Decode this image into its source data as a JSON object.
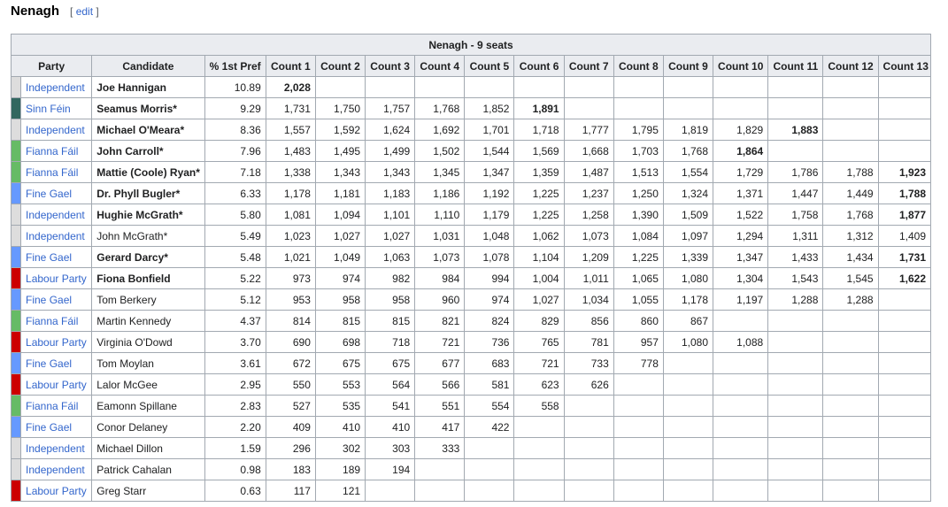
{
  "section": {
    "title": "Nenagh",
    "edit_open": "[ ",
    "edit_label": "edit",
    "edit_close": " ]"
  },
  "table": {
    "caption": "Nenagh - 9 seats",
    "headers": [
      "Party",
      "Candidate",
      "% 1st Pref",
      "Count 1",
      "Count 2",
      "Count 3",
      "Count 4",
      "Count 5",
      "Count 6",
      "Count 7",
      "Count 8",
      "Count 9",
      "Count 10",
      "Count 11",
      "Count 12",
      "Count 13"
    ],
    "rows": [
      {
        "party": "Independent",
        "color": "#dddddd",
        "candidate": "Joe Hannigan",
        "elected": true,
        "pct": "10.89",
        "counts": [
          "2,028"
        ],
        "bold_count": 0
      },
      {
        "party": "Sinn Féin",
        "color": "#326760",
        "candidate": "Seamus Morris*",
        "elected": true,
        "pct": "9.29",
        "counts": [
          "1,731",
          "1,750",
          "1,757",
          "1,768",
          "1,852",
          "1,891"
        ],
        "bold_count": 5
      },
      {
        "party": "Independent",
        "color": "#dddddd",
        "candidate": "Michael O'Meara*",
        "elected": true,
        "pct": "8.36",
        "counts": [
          "1,557",
          "1,592",
          "1,624",
          "1,692",
          "1,701",
          "1,718",
          "1,777",
          "1,795",
          "1,819",
          "1,829",
          "1,883"
        ],
        "bold_count": 10
      },
      {
        "party": "Fianna Fáil",
        "color": "#66bb66",
        "candidate": "John Carroll*",
        "elected": true,
        "pct": "7.96",
        "counts": [
          "1,483",
          "1,495",
          "1,499",
          "1,502",
          "1,544",
          "1,569",
          "1,668",
          "1,703",
          "1,768",
          "1,864"
        ],
        "bold_count": 9
      },
      {
        "party": "Fianna Fáil",
        "color": "#66bb66",
        "candidate": "Mattie (Coole) Ryan*",
        "elected": true,
        "pct": "7.18",
        "counts": [
          "1,338",
          "1,343",
          "1,343",
          "1,345",
          "1,347",
          "1,359",
          "1,487",
          "1,513",
          "1,554",
          "1,729",
          "1,786",
          "1,788",
          "1,923"
        ],
        "bold_count": 12
      },
      {
        "party": "Fine Gael",
        "color": "#6699ff",
        "candidate": "Dr. Phyll Bugler*",
        "elected": true,
        "pct": "6.33",
        "counts": [
          "1,178",
          "1,181",
          "1,183",
          "1,186",
          "1,192",
          "1,225",
          "1,237",
          "1,250",
          "1,324",
          "1,371",
          "1,447",
          "1,449",
          "1,788"
        ],
        "bold_count": 12
      },
      {
        "party": "Independent",
        "color": "#dddddd",
        "candidate": "Hughie McGrath*",
        "elected": true,
        "pct": "5.80",
        "counts": [
          "1,081",
          "1,094",
          "1,101",
          "1,110",
          "1,179",
          "1,225",
          "1,258",
          "1,390",
          "1,509",
          "1,522",
          "1,758",
          "1,768",
          "1,877"
        ],
        "bold_count": 12
      },
      {
        "party": "Independent",
        "color": "#dddddd",
        "candidate": "John McGrath*",
        "elected": false,
        "pct": "5.49",
        "counts": [
          "1,023",
          "1,027",
          "1,027",
          "1,031",
          "1,048",
          "1,062",
          "1,073",
          "1,084",
          "1,097",
          "1,294",
          "1,311",
          "1,312",
          "1,409"
        ],
        "bold_count": -1
      },
      {
        "party": "Fine Gael",
        "color": "#6699ff",
        "candidate": "Gerard Darcy*",
        "elected": true,
        "pct": "5.48",
        "counts": [
          "1,021",
          "1,049",
          "1,063",
          "1,073",
          "1,078",
          "1,104",
          "1,209",
          "1,225",
          "1,339",
          "1,347",
          "1,433",
          "1,434",
          "1,731"
        ],
        "bold_count": 12
      },
      {
        "party": "Labour Party",
        "color": "#cc0000",
        "candidate": "Fiona Bonfield",
        "elected": true,
        "pct": "5.22",
        "counts": [
          "973",
          "974",
          "982",
          "984",
          "994",
          "1,004",
          "1,011",
          "1,065",
          "1,080",
          "1,304",
          "1,543",
          "1,545",
          "1,622"
        ],
        "bold_count": 12
      },
      {
        "party": "Fine Gael",
        "color": "#6699ff",
        "candidate": "Tom Berkery",
        "elected": false,
        "pct": "5.12",
        "counts": [
          "953",
          "958",
          "958",
          "960",
          "974",
          "1,027",
          "1,034",
          "1,055",
          "1,178",
          "1,197",
          "1,288",
          "1,288"
        ],
        "bold_count": -1
      },
      {
        "party": "Fianna Fáil",
        "color": "#66bb66",
        "candidate": "Martin Kennedy",
        "elected": false,
        "pct": "4.37",
        "counts": [
          "814",
          "815",
          "815",
          "821",
          "824",
          "829",
          "856",
          "860",
          "867"
        ],
        "bold_count": -1
      },
      {
        "party": "Labour Party",
        "color": "#cc0000",
        "candidate": "Virginia O'Dowd",
        "elected": false,
        "pct": "3.70",
        "counts": [
          "690",
          "698",
          "718",
          "721",
          "736",
          "765",
          "781",
          "957",
          "1,080",
          "1,088"
        ],
        "bold_count": -1
      },
      {
        "party": "Fine Gael",
        "color": "#6699ff",
        "candidate": "Tom Moylan",
        "elected": false,
        "pct": "3.61",
        "counts": [
          "672",
          "675",
          "675",
          "677",
          "683",
          "721",
          "733",
          "778"
        ],
        "bold_count": -1
      },
      {
        "party": "Labour Party",
        "color": "#cc0000",
        "candidate": "Lalor McGee",
        "elected": false,
        "pct": "2.95",
        "counts": [
          "550",
          "553",
          "564",
          "566",
          "581",
          "623",
          "626"
        ],
        "bold_count": -1
      },
      {
        "party": "Fianna Fáil",
        "color": "#66bb66",
        "candidate": "Eamonn Spillane",
        "elected": false,
        "pct": "2.83",
        "counts": [
          "527",
          "535",
          "541",
          "551",
          "554",
          "558"
        ],
        "bold_count": -1
      },
      {
        "party": "Fine Gael",
        "color": "#6699ff",
        "candidate": "Conor Delaney",
        "elected": false,
        "pct": "2.20",
        "counts": [
          "409",
          "410",
          "410",
          "417",
          "422"
        ],
        "bold_count": -1
      },
      {
        "party": "Independent",
        "color": "#dddddd",
        "candidate": "Michael Dillon",
        "elected": false,
        "pct": "1.59",
        "counts": [
          "296",
          "302",
          "303",
          "333"
        ],
        "bold_count": -1
      },
      {
        "party": "Independent",
        "color": "#dddddd",
        "candidate": "Patrick Cahalan",
        "elected": false,
        "pct": "0.98",
        "counts": [
          "183",
          "189",
          "194"
        ],
        "bold_count": -1
      },
      {
        "party": "Labour Party",
        "color": "#cc0000",
        "candidate": "Greg Starr",
        "elected": false,
        "pct": "0.63",
        "counts": [
          "117",
          "121"
        ],
        "bold_count": -1
      }
    ]
  }
}
